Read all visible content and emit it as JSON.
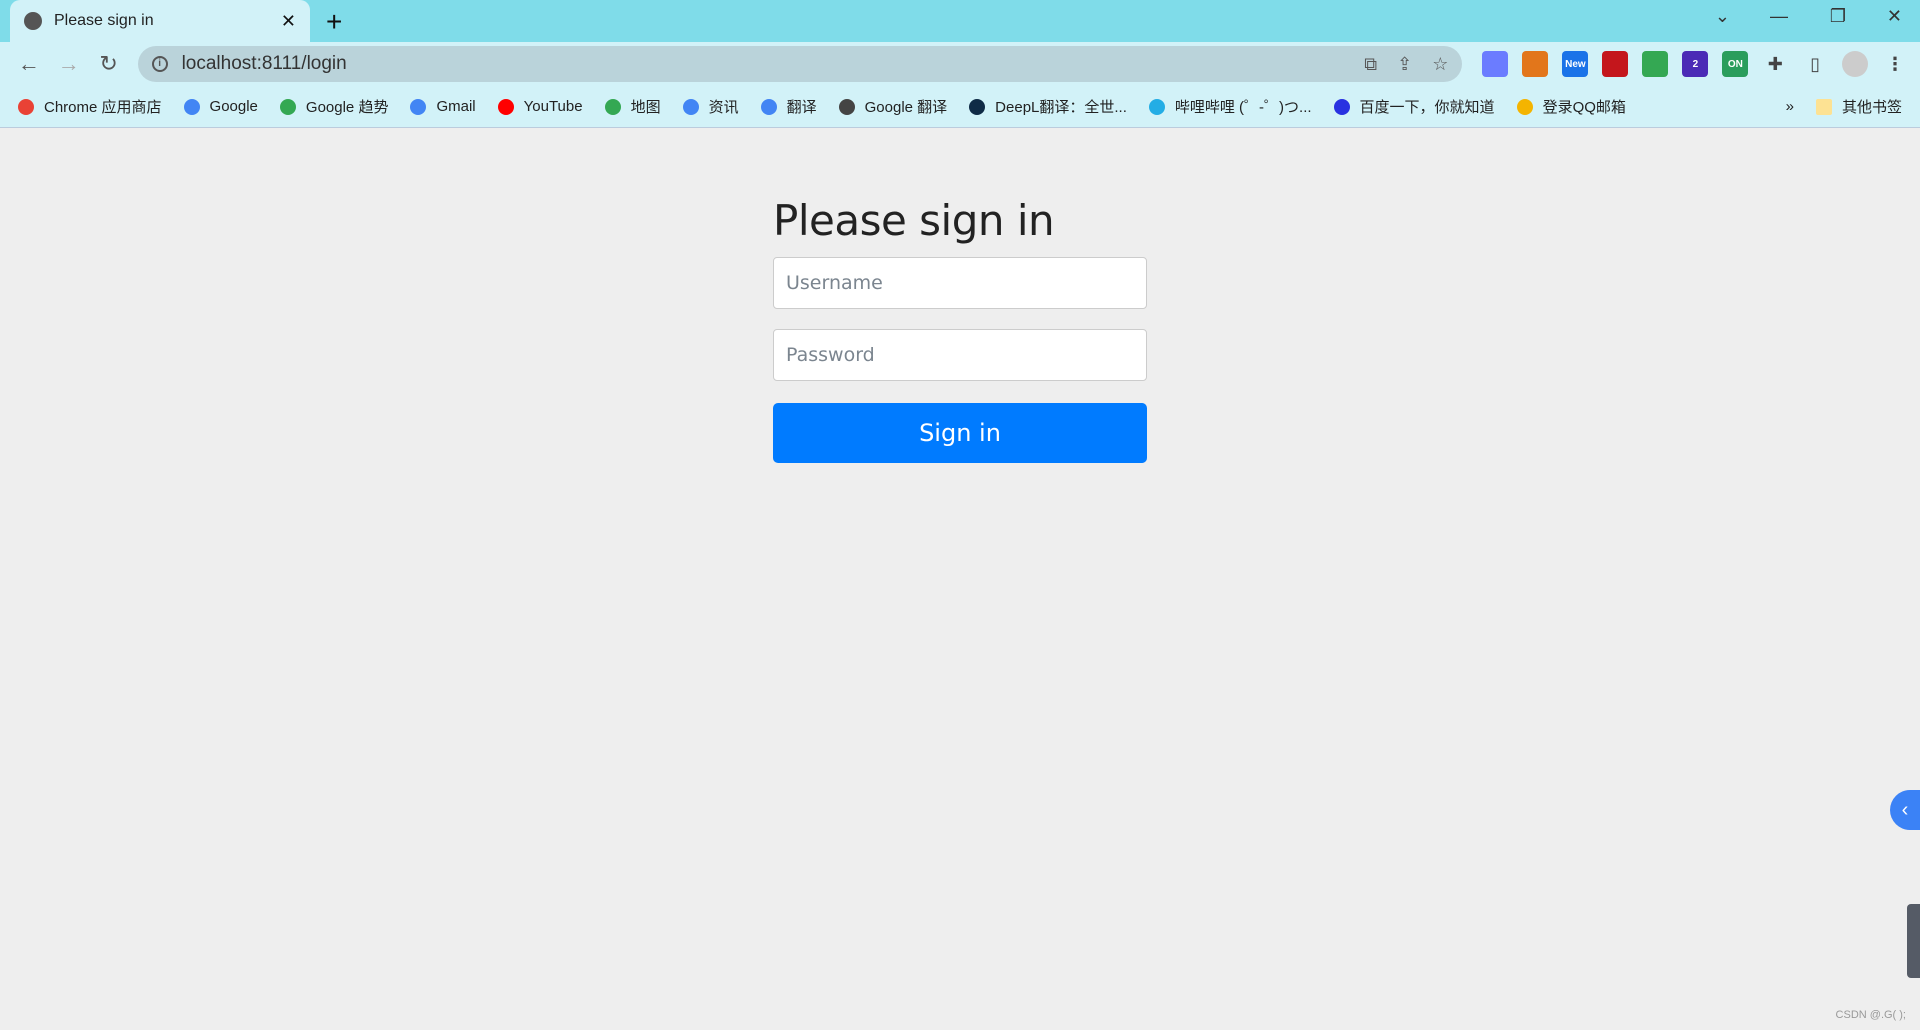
{
  "browser": {
    "tab_title": "Please sign in",
    "url": "localhost:8111/login",
    "extensions": [
      {
        "label": "",
        "color": "#6b7cff"
      },
      {
        "label": "",
        "color": "#e2761b"
      },
      {
        "label": "New",
        "color": "#1a73e8"
      },
      {
        "label": "",
        "color": "#c4161c"
      },
      {
        "label": "",
        "color": "#34a853"
      },
      {
        "label": "2",
        "color": "#4b2bb6"
      },
      {
        "label": "ON",
        "color": "#2a9d5c"
      }
    ],
    "bookmarks": [
      {
        "label": "Chrome 应用商店",
        "color": "#e94235"
      },
      {
        "label": "Google",
        "color": "#4285f4"
      },
      {
        "label": "Google 趋势",
        "color": "#34a853"
      },
      {
        "label": "Gmail",
        "color": "#4285f4"
      },
      {
        "label": "YouTube",
        "color": "#ff0000"
      },
      {
        "label": "地图",
        "color": "#34a853"
      },
      {
        "label": "资讯",
        "color": "#4285f4"
      },
      {
        "label": "翻译",
        "color": "#4285f4"
      },
      {
        "label": "Google 翻译",
        "color": "#444444"
      },
      {
        "label": "DeepL翻译：全世...",
        "color": "#0f2b46"
      },
      {
        "label": "哔哩哔哩 (゜-゜)つ...",
        "color": "#23ade5"
      },
      {
        "label": "百度一下，你就知道",
        "color": "#2932e1"
      },
      {
        "label": "登录QQ邮箱",
        "color": "#f4b400"
      }
    ],
    "overflow": "»",
    "other_bookmarks": "其他书签"
  },
  "form": {
    "heading": "Please sign in",
    "username_placeholder": "Username",
    "password_placeholder": "Password",
    "submit_label": "Sign in",
    "accent": "#007bff"
  },
  "watermark": "CSDN @.G( );"
}
